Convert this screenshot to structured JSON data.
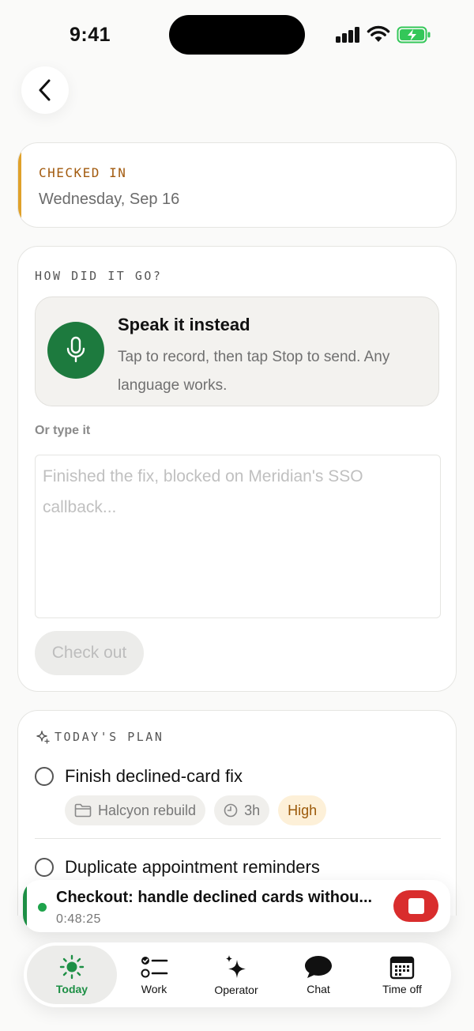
{
  "status_bar": {
    "time": "9:41"
  },
  "checked_in": {
    "label": "CHECKED IN",
    "date": "Wednesday, Sep 16"
  },
  "checkout_form": {
    "heading": "HOW DID IT GO?",
    "speak": {
      "title": "Speak it instead",
      "subtitle": "Tap to record, then tap Stop to send. Any language works."
    },
    "or_type_label": "Or type it",
    "placeholder": "Finished the fix, blocked on Meridian's SSO callback...",
    "value": "",
    "checkout_label": "Check out"
  },
  "plan": {
    "heading": "TODAY'S PLAN",
    "tasks": [
      {
        "title": "Finish declined-card fix",
        "project": "Halcyon rebuild",
        "estimate": "3h",
        "priority": "High"
      },
      {
        "title": "Duplicate appointment reminders"
      }
    ]
  },
  "timer": {
    "title": "Checkout: handle declined cards withou...",
    "elapsed": "0:48:25"
  },
  "tabs": [
    {
      "label": "Today",
      "icon": "sun-icon",
      "active": true
    },
    {
      "label": "Work",
      "icon": "checklist-icon",
      "active": false
    },
    {
      "label": "Operator",
      "icon": "sparkles-icon",
      "active": false
    },
    {
      "label": "Chat",
      "icon": "chat-bubble-icon",
      "active": false
    },
    {
      "label": "Time off",
      "icon": "calendar-icon",
      "active": false
    }
  ],
  "colors": {
    "accent_green": "#1d7a3e",
    "active_tab_green": "#1d8f45",
    "checked_in_orange": "#a25a0e",
    "checked_in_bar": "#e0a12a",
    "stop_red": "#d92d2d",
    "priority_high_bg": "#fdf0d8"
  }
}
